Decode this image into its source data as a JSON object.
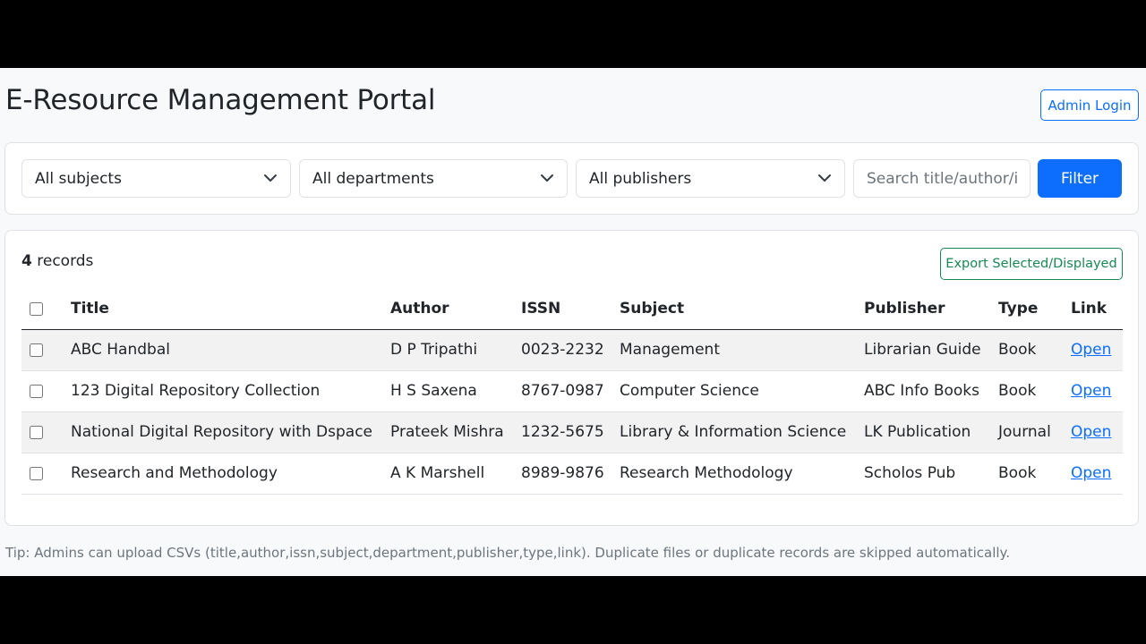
{
  "header": {
    "title": "E-Resource Management Portal",
    "admin_login_label": "Admin Login"
  },
  "filters": {
    "subject_selected": "All subjects",
    "department_selected": "All departments",
    "publisher_selected": "All publishers",
    "search_placeholder": "Search title/author/issn",
    "filter_label": "Filter"
  },
  "records": {
    "count": "4",
    "count_suffix": " records",
    "export_label": "Export Selected/Displayed",
    "columns": [
      "Title",
      "Author",
      "ISSN",
      "Subject",
      "Publisher",
      "Type",
      "Link"
    ],
    "rows": [
      {
        "title": "ABC Handbal",
        "author": "D P Tripathi",
        "issn": "0023-2232",
        "subject": "Management",
        "publisher": "Librarian Guide",
        "type": "Book",
        "link": "Open"
      },
      {
        "title": "123 Digital Repository Collection",
        "author": "H S Saxena",
        "issn": "8767-0987",
        "subject": "Computer Science",
        "publisher": "ABC Info Books",
        "type": "Book",
        "link": "Open"
      },
      {
        "title": "National Digital Repository with Dspace",
        "author": "Prateek Mishra",
        "issn": "1232-5675",
        "subject": "Library & Information Science",
        "publisher": "LK Publication",
        "type": "Journal",
        "link": "Open"
      },
      {
        "title": "Research and Methodology",
        "author": "A K Marshell",
        "issn": "8989-9876",
        "subject": "Research Methodology",
        "publisher": "Scholos Pub",
        "type": "Book",
        "link": "Open"
      }
    ]
  },
  "tip": "Tip: Admins can upload CSVs (title,author,issn,subject,department,publisher,type,link). Duplicate files or duplicate records are skipped automatically.",
  "colors": {
    "primary": "#0d6efd",
    "success": "#198754",
    "muted": "#6c757d",
    "page_background": "#f8f9fa"
  }
}
